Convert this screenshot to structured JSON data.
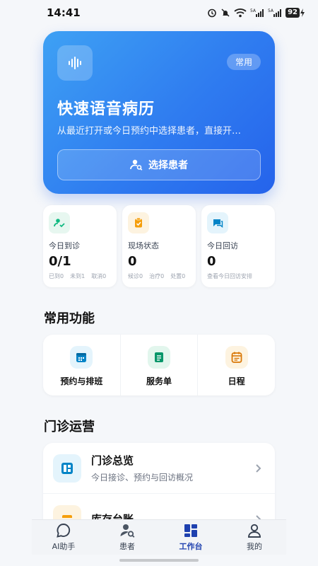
{
  "status_bar": {
    "time": "14:41",
    "battery": "92"
  },
  "hero": {
    "badge": "常用",
    "title": "快速语音病历",
    "subtitle": "从最近打开或今日预约中选择患者，直接开…",
    "button_label": "选择患者",
    "icon": "voice-wave-icon"
  },
  "stats": [
    {
      "label": "今日到诊",
      "value": "0/1",
      "subs": [
        "已到0",
        "未到1",
        "取消0"
      ],
      "icon": "user-check-icon",
      "color": "#10b981"
    },
    {
      "label": "现场状态",
      "value": "0",
      "subs": [
        "候诊0",
        "治疗0",
        "处置0"
      ],
      "icon": "clipboard-icon",
      "color": "#f59e0b"
    },
    {
      "label": "今日回访",
      "value": "0",
      "subs": [
        "查看今日回访安排"
      ],
      "icon": "chat-icon",
      "color": "#0ea5e9"
    }
  ],
  "sections": {
    "features_title": "常用功能",
    "ops_title": "门诊运营"
  },
  "features": [
    {
      "label": "预约与排班",
      "icon": "calendar-icon",
      "color": "#0ea5e9"
    },
    {
      "label": "服务单",
      "icon": "document-icon",
      "color": "#10b981"
    },
    {
      "label": "日程",
      "icon": "schedule-icon",
      "color": "#f59e0b"
    }
  ],
  "ops": [
    {
      "title": "门诊总览",
      "desc": "今日接诊、预约与回访概况",
      "icon": "dashboard-icon",
      "color": "#0ea5e9"
    },
    {
      "title": "库存台账",
      "desc": "",
      "icon": "inventory-icon",
      "color": "#f59e0b"
    }
  ],
  "tabs": [
    {
      "label": "AI助手",
      "icon": "chat-bubble-icon",
      "active": false
    },
    {
      "label": "患者",
      "icon": "patient-search-icon",
      "active": false
    },
    {
      "label": "工作台",
      "icon": "workbench-grid-icon",
      "active": true
    },
    {
      "label": "我的",
      "icon": "profile-icon",
      "active": false
    }
  ]
}
